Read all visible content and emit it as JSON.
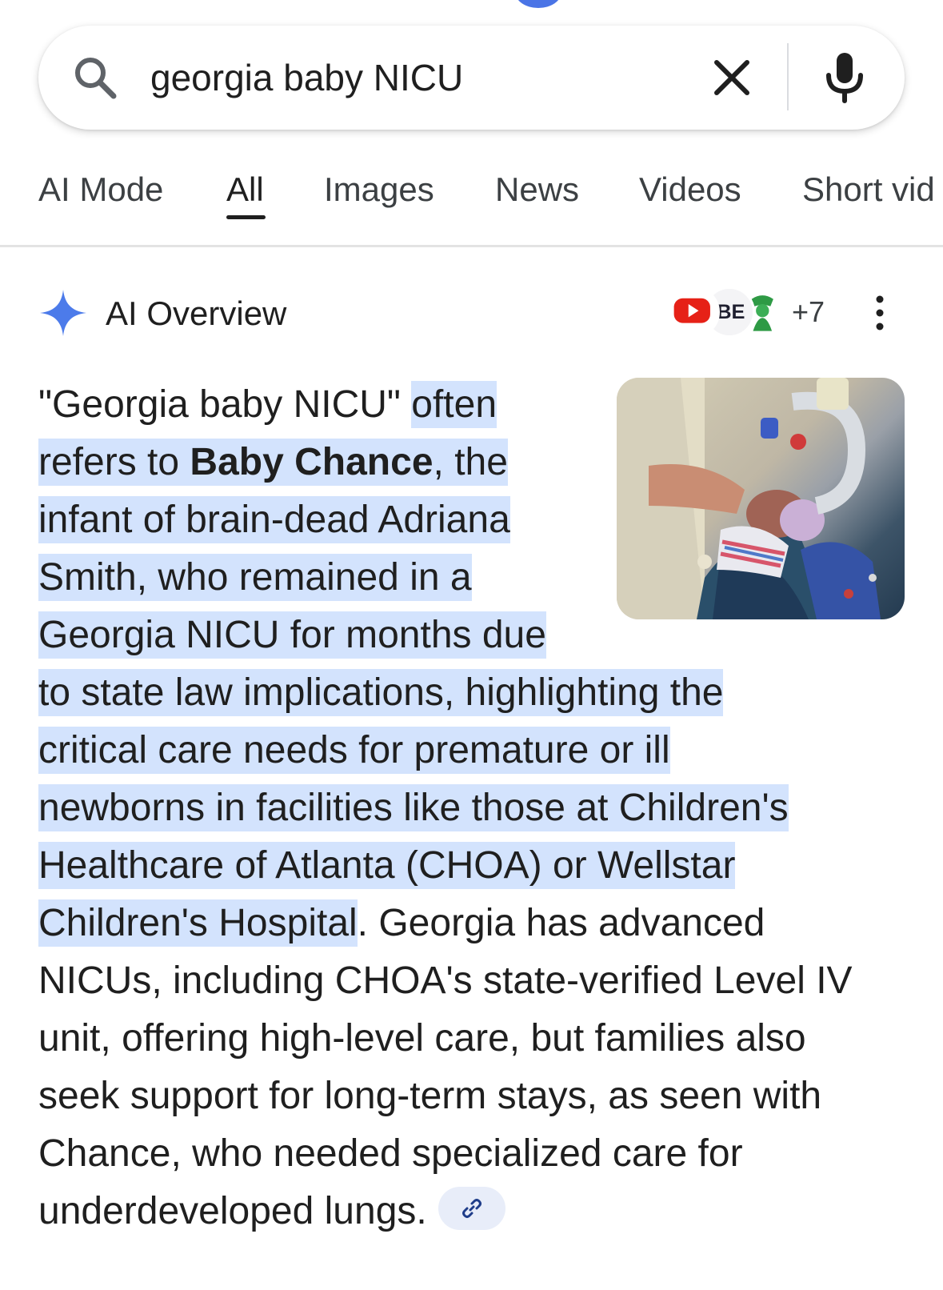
{
  "search": {
    "query": "georgia baby NICU"
  },
  "tabs": [
    {
      "label": "AI Mode",
      "active": false
    },
    {
      "label": "All",
      "active": true
    },
    {
      "label": "Images",
      "active": false
    },
    {
      "label": "News",
      "active": false
    },
    {
      "label": "Videos",
      "active": false
    },
    {
      "label": "Short vid",
      "active": false
    }
  ],
  "ai_overview": {
    "title": "AI Overview",
    "sources_more": "+7",
    "avatar_be_text": "BE",
    "lines": [
      {
        "plain": "\"Georgia baby NICU\" ",
        "hl": "often"
      },
      {
        "hl_pre": "refers to ",
        "bold": "Baby Chance",
        "hl_post": ", the"
      },
      {
        "hl": "infant of brain-dead Adriana"
      },
      {
        "hl": "Smith, who remained in a"
      },
      {
        "hl": "Georgia NICU for months due"
      },
      {
        "hl": "to state law implications, highlighting the"
      },
      {
        "hl": "critical care needs for premature or ill"
      },
      {
        "hl": "newborns in facilities like those at Children's"
      },
      {
        "hl": "Healthcare of Atlanta (CHOA) or Wellstar"
      },
      {
        "hl": "Children's Hospital",
        "plain": ". Georgia has advanced"
      },
      {
        "plain": "NICUs, including CHOA's state-verified Level IV"
      },
      {
        "plain": "unit, offering high-level care, but families also"
      },
      {
        "plain": "seek support for long-term stays, as seen with"
      },
      {
        "plain": "Chance, who needed specialized care for"
      },
      {
        "plain": "underdeveloped lungs."
      }
    ]
  },
  "colors": {
    "highlight": "#d3e3fd",
    "sparkle": "#4c7bea",
    "youtube_red": "#e62117",
    "link_chip": "#e8edf9"
  },
  "icons": [
    "search-icon",
    "clear-icon",
    "mic-icon",
    "sparkle-icon",
    "kebab-icon",
    "link-icon",
    "youtube-icon"
  ]
}
